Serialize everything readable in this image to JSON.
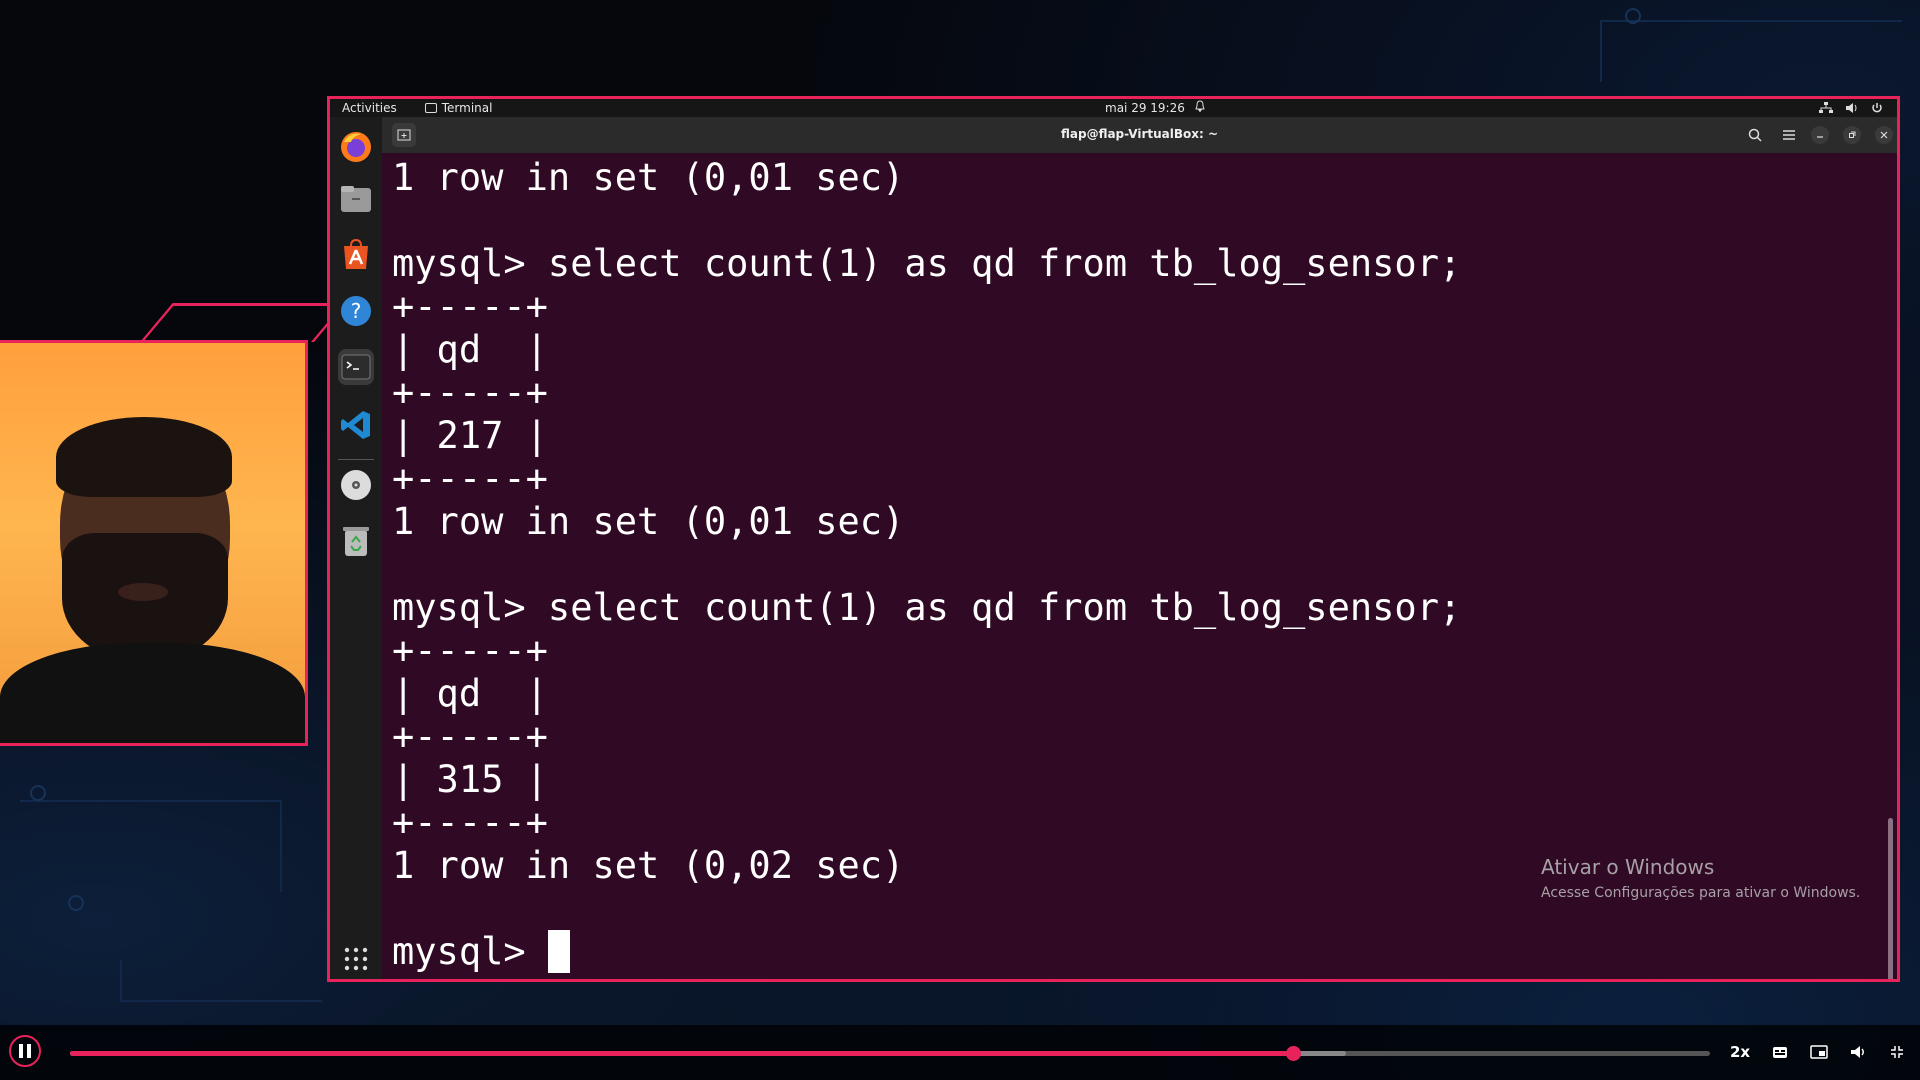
{
  "ubuntu_top_bar": {
    "activities": "Activities",
    "app_name": "Terminal",
    "clock": "mai 29  19:26"
  },
  "window": {
    "title": "flap@flap-VirtualBox: ~"
  },
  "terminal": {
    "lines": [
      "1 row in set (0,01 sec)",
      "",
      "mysql> select count(1) as qd from tb_log_sensor;",
      "+-----+",
      "| qd  |",
      "+-----+",
      "| 217 |",
      "+-----+",
      "1 row in set (0,01 sec)",
      "",
      "mysql> select count(1) as qd from tb_log_sensor;",
      "+-----+",
      "| qd  |",
      "+-----+",
      "| 315 |",
      "+-----+",
      "1 row in set (0,02 sec)",
      "",
      "mysql> "
    ]
  },
  "watermark": {
    "title": "Ativar o Windows",
    "subtitle": "Acesse Configurações para ativar o Windows."
  },
  "player": {
    "progress_fraction": 0.746,
    "buffered_fraction": 0.778,
    "speed_label": "2x"
  },
  "dock_icons": [
    "firefox-icon",
    "files-icon",
    "app-center-icon",
    "help-icon",
    "terminal-icon",
    "vscode-icon",
    "disc-icon",
    "trash-icon"
  ],
  "colors": {
    "accent": "#e8235b",
    "terminal_bg": "#300a24"
  }
}
